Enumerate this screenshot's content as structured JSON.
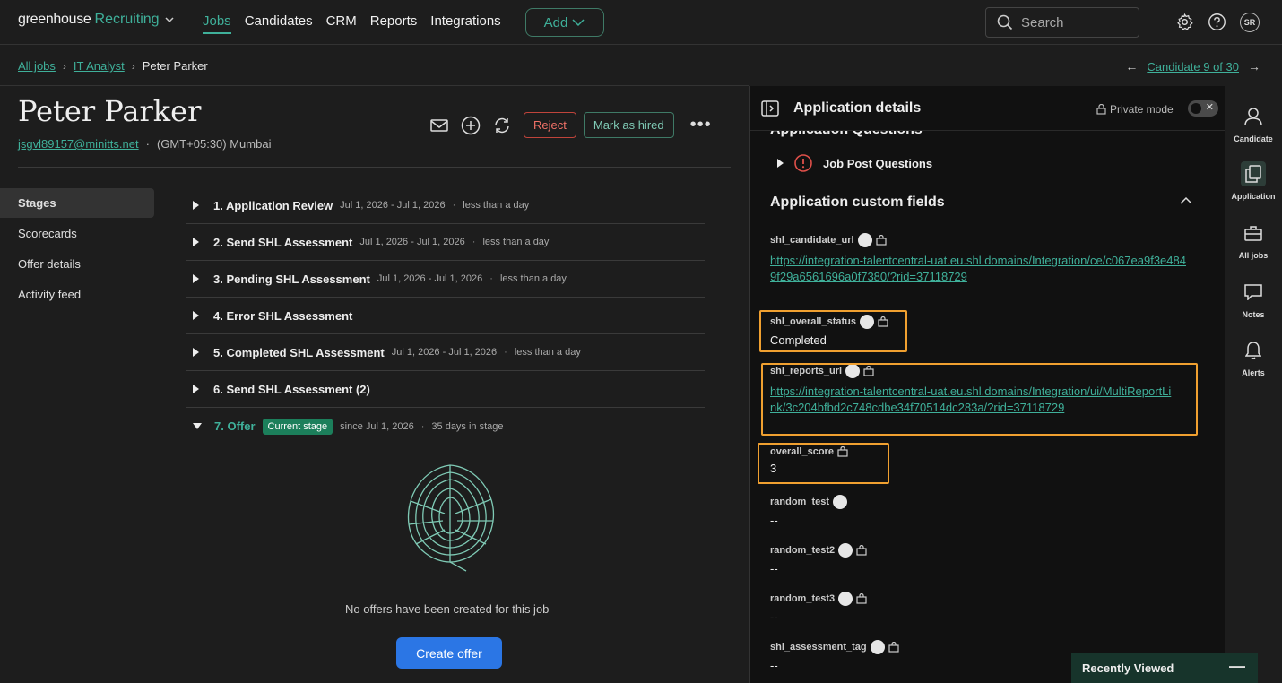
{
  "topbar": {
    "logo_main": "greenhouse",
    "logo_product": "Recruiting",
    "nav": [
      "Jobs",
      "Candidates",
      "CRM",
      "Reports",
      "Integrations"
    ],
    "add_label": "Add",
    "search_placeholder": "Search",
    "avatar_initials": "SR"
  },
  "breadcrumb": {
    "all_jobs": "All jobs",
    "job": "IT Analyst",
    "current": "Peter Parker"
  },
  "candidate_nav": {
    "label": "Candidate 9 of 30"
  },
  "candidate": {
    "name": "Peter Parker",
    "email": "jsgvl89157@minitts.net",
    "timezone": "(GMT+05:30) Mumbai",
    "reject_label": "Reject",
    "hired_label": "Mark as hired"
  },
  "sidemenu": [
    "Stages",
    "Scorecards",
    "Offer details",
    "Activity feed"
  ],
  "stages": [
    {
      "name": "1. Application Review",
      "date": "Jul 1, 2026 - Jul 1, 2026",
      "duration": "less than a day"
    },
    {
      "name": "2. Send SHL Assessment",
      "date": "Jul 1, 2026 - Jul 1, 2026",
      "duration": "less than a day"
    },
    {
      "name": "3. Pending SHL Assessment",
      "date": "Jul 1, 2026 - Jul 1, 2026",
      "duration": "less than a day"
    },
    {
      "name": "4. Error SHL Assessment",
      "date": "",
      "duration": ""
    },
    {
      "name": "5. Completed SHL Assessment",
      "date": "Jul 1, 2026 - Jul 1, 2026",
      "duration": "less than a day"
    },
    {
      "name": "6. Send SHL Assessment (2)",
      "date": "",
      "duration": ""
    },
    {
      "name": "7. Offer",
      "badge": "Current stage",
      "date": "since Jul 1, 2026",
      "duration": "35 days in stage"
    }
  ],
  "offer": {
    "empty_text": "No offers have been created for this job",
    "create_label": "Create offer"
  },
  "panel": {
    "title": "Application details",
    "private_mode": "Private mode",
    "questions_title": "Application Questions",
    "job_post_questions": "Job Post Questions",
    "custom_fields_title": "Application custom fields",
    "fields": {
      "candidate_url": {
        "label": "shl_candidate_url",
        "value": "https://integration-talentcentral-uat.eu.shl.domains/Integration/ce/c067ea9f3e4849f29a6561696a0f7380/?rid=37118729"
      },
      "overall_status": {
        "label": "shl_overall_status",
        "value": "Completed"
      },
      "reports_url": {
        "label": "shl_reports_url",
        "value": "https://integration-talentcentral-uat.eu.shl.domains/Integration/ui/MultiReportLink/3c204bfbd2c748cdbe34f70514dc283a/?rid=37118729"
      },
      "overall_score": {
        "label": "overall_score",
        "value": "3"
      },
      "random_test": {
        "label": "random_test",
        "value": "--"
      },
      "random_test2": {
        "label": "random_test2",
        "value": "--"
      },
      "random_test3": {
        "label": "random_test3",
        "value": "--"
      },
      "assessment_tag": {
        "label": "shl_assessment_tag",
        "value": "--"
      }
    }
  },
  "rail": [
    "Candidate",
    "Application",
    "All jobs",
    "Notes",
    "Alerts"
  ],
  "recently_viewed": "Recently Viewed",
  "colors": {
    "accent": "#3fb09a",
    "highlight": "#f0a030",
    "reject": "#c0443b",
    "primary": "#2b76e5"
  }
}
